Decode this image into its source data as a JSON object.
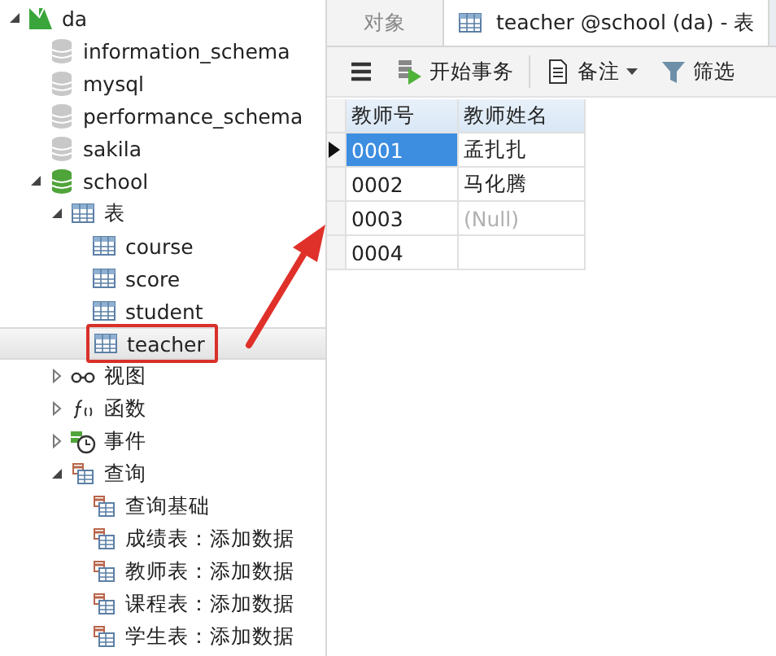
{
  "sidebar": {
    "tree": [
      {
        "label": "da",
        "kind": "server",
        "expanded": true,
        "selected": false,
        "children": [
          {
            "label": "information_schema",
            "kind": "db",
            "selected": false
          },
          {
            "label": "mysql",
            "kind": "db",
            "selected": false
          },
          {
            "label": "performance_schema",
            "kind": "db",
            "selected": false
          },
          {
            "label": "sakila",
            "kind": "db",
            "selected": false
          },
          {
            "label": "school",
            "kind": "db-open",
            "expanded": true,
            "selected": false,
            "children": [
              {
                "label": "表",
                "kind": "tables",
                "expanded": true,
                "selected": false,
                "children": [
                  {
                    "label": "course",
                    "kind": "table",
                    "selected": false,
                    "marked": false
                  },
                  {
                    "label": "score",
                    "kind": "table",
                    "selected": false,
                    "marked": false
                  },
                  {
                    "label": "student",
                    "kind": "table",
                    "selected": false,
                    "marked": false
                  },
                  {
                    "label": "teacher",
                    "kind": "table",
                    "selected": true,
                    "marked": true
                  }
                ]
              },
              {
                "label": "视图",
                "kind": "views",
                "expanded": false,
                "selected": false
              },
              {
                "label": "函数",
                "kind": "functions",
                "expanded": false,
                "selected": false
              },
              {
                "label": "事件",
                "kind": "events",
                "expanded": false,
                "selected": false
              },
              {
                "label": "查询",
                "kind": "queries",
                "expanded": true,
                "selected": false,
                "children": [
                  {
                    "label": "查询基础",
                    "kind": "query",
                    "selected": false
                  },
                  {
                    "label": "成绩表：添加数据",
                    "kind": "query",
                    "selected": false
                  },
                  {
                    "label": "教师表：添加数据",
                    "kind": "query",
                    "selected": false
                  },
                  {
                    "label": "课程表：添加数据",
                    "kind": "query",
                    "selected": false
                  },
                  {
                    "label": "学生表：添加数据",
                    "kind": "query",
                    "selected": false
                  }
                ]
              }
            ]
          }
        ]
      }
    ]
  },
  "tabs": [
    {
      "label": "对象",
      "kind": "plain",
      "selected": false
    },
    {
      "label": "teacher @school (da) - 表",
      "kind": "table",
      "selected": true
    }
  ],
  "toolbar": [
    {
      "kind": "menu"
    },
    {
      "label": "开始事务",
      "kind": "transaction"
    },
    {
      "label": "备注",
      "kind": "memo"
    },
    {
      "label": "筛选",
      "kind": "filter"
    }
  ],
  "table": {
    "columns": [
      "教师号",
      "教师姓名"
    ],
    "rows": [
      {
        "selected": true,
        "cells": [
          {
            "text": "0001",
            "null": false
          },
          {
            "text": "孟扎扎",
            "null": false
          }
        ]
      },
      {
        "selected": false,
        "cells": [
          {
            "text": "0002",
            "null": false
          },
          {
            "text": "马化腾",
            "null": false
          }
        ]
      },
      {
        "selected": false,
        "cells": [
          {
            "text": "0003",
            "null": false
          },
          {
            "text": "(Null)",
            "null": true
          }
        ]
      },
      {
        "selected": false,
        "cells": [
          {
            "text": "0004",
            "null": false
          }
        ]
      }
    ]
  }
}
